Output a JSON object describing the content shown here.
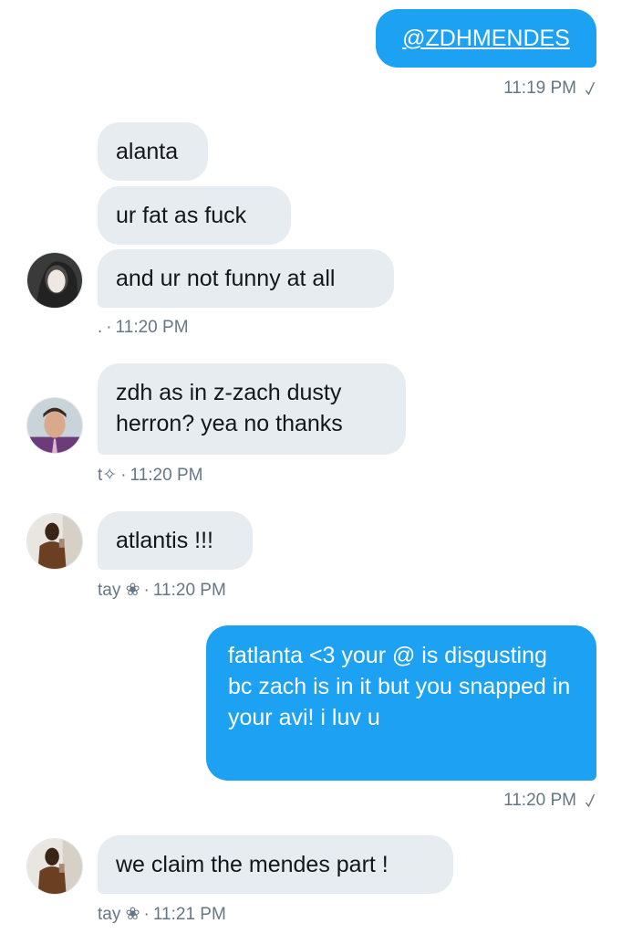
{
  "conversation": {
    "messages": [
      {
        "id": "m1",
        "direction": "outgoing",
        "text": "@ZDHMENDES"
      },
      {
        "id": "m2",
        "direction": "incoming",
        "text": "alanta"
      },
      {
        "id": "m3",
        "direction": "incoming",
        "text": "ur fat as fuck"
      },
      {
        "id": "m4",
        "direction": "incoming",
        "text": "and ur not funny at all"
      },
      {
        "id": "m5",
        "direction": "incoming",
        "text": "zdh as in z-zach dusty herron?  yea no thanks"
      },
      {
        "id": "m6",
        "direction": "incoming",
        "text": "atlantis !!!"
      },
      {
        "id": "m7",
        "direction": "outgoing",
        "text": "fatlanta <3 your @ is disgusting bc zach is in it but you snapped in your avi! i luv u"
      },
      {
        "id": "m8",
        "direction": "incoming",
        "text": "we claim the mendes part !"
      }
    ],
    "meta": {
      "t1": {
        "time": "11:19 PM",
        "read_icon": "checkmark-icon"
      },
      "t2": {
        "sender": ". ",
        "time": "11:20 PM"
      },
      "t3": {
        "sender": "t✧",
        "time": "11:20 PM"
      },
      "t4": {
        "sender": "tay ❀",
        "time": "11:20 PM"
      },
      "t5": {
        "time": "11:20 PM",
        "read_icon": "checkmark-icon"
      },
      "t6": {
        "sender": "tay ❀",
        "time": "11:21 PM"
      }
    },
    "separator": "·"
  },
  "colors": {
    "outgoing_bubble": "#1da1f2",
    "incoming_bubble": "#e6ecf0",
    "meta_text": "#657786"
  }
}
